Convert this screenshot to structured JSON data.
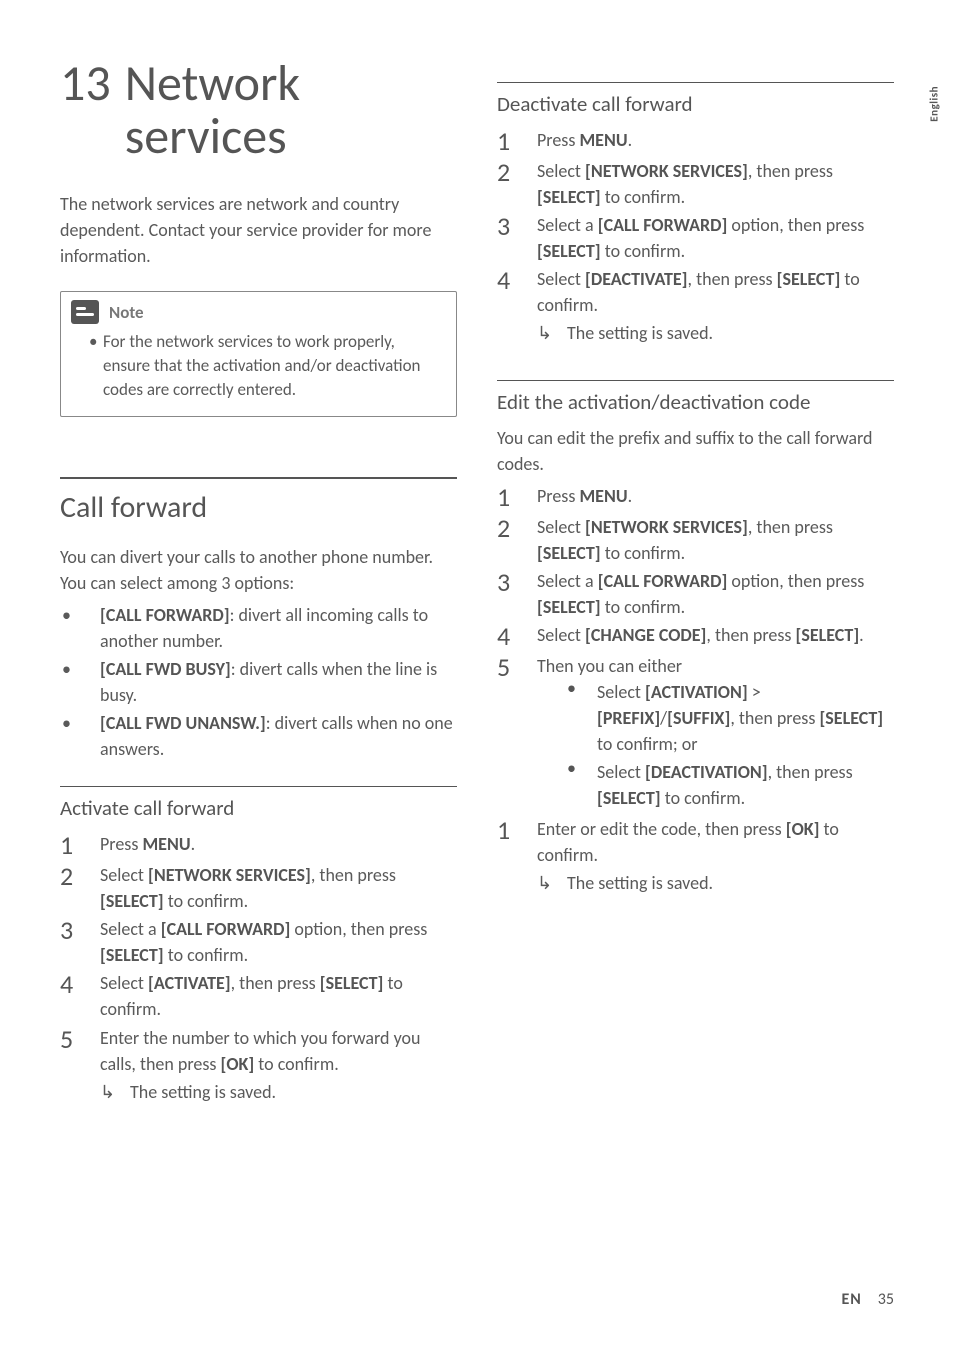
{
  "lang_tab": "English",
  "chapter": {
    "number": "13",
    "title": "Network services"
  },
  "intro": "The network services are network and country dependent. Contact your service provider for more information.",
  "note": {
    "label": "Note",
    "text": "For the network services to work properly, ensure that the activation and/or deactivation codes are correctly entered."
  },
  "section_call_forward": {
    "title": "Call forward",
    "intro": "You can divert your calls to another phone number. You can select among 3 options:",
    "options": [
      {
        "label": "[CALL FORWARD]",
        "desc": ": divert all incoming calls to another number."
      },
      {
        "label": "[CALL FWD BUSY]",
        "desc": ": divert calls when the line is busy."
      },
      {
        "label": "[CALL FWD UNANSW.]",
        "desc": ": divert calls when no one answers."
      }
    ]
  },
  "activate": {
    "title": "Activate call forward",
    "steps": [
      {
        "pre": "Press ",
        "b1": "MENU",
        "post": "."
      },
      {
        "pre": "Select ",
        "b1": "[NETWORK SERVICES]",
        "mid": ", then press ",
        "b2": "[SELECT]",
        "post": " to confirm."
      },
      {
        "pre": "Select a ",
        "b1": "[CALL FORWARD]",
        "mid": " option, then press ",
        "b2": "[SELECT]",
        "post": " to confirm."
      },
      {
        "pre": "Select ",
        "b1": "[ACTIVATE]",
        "mid": ", then press ",
        "b2": "[SELECT]",
        "post": " to confirm."
      },
      {
        "pre": "Enter the number to which you forward you calls, then press ",
        "b1": "[OK]",
        "post": " to confirm."
      }
    ],
    "result": "The setting is saved."
  },
  "deactivate": {
    "title": "Deactivate call forward",
    "steps": [
      {
        "pre": "Press ",
        "b1": "MENU",
        "post": "."
      },
      {
        "pre": "Select ",
        "b1": "[NETWORK SERVICES]",
        "mid": ", then press ",
        "b2": "[SELECT]",
        "post": " to confirm."
      },
      {
        "pre": "Select a ",
        "b1": "[CALL FORWARD]",
        "mid": " option, then press ",
        "b2": "[SELECT]",
        "post": " to confirm."
      },
      {
        "pre": "Select ",
        "b1": "[DEACTIVATE]",
        "mid": ", then press ",
        "b2": "[SELECT]",
        "post": " to confirm."
      }
    ],
    "result": "The setting is saved."
  },
  "edit_code": {
    "title": "Edit the activation/deactivation code",
    "intro": "You can edit the prefix and suffix to the call forward codes.",
    "steps": [
      {
        "pre": "Press ",
        "b1": "MENU",
        "post": "."
      },
      {
        "pre": "Select ",
        "b1": "[NETWORK SERVICES]",
        "mid": ", then press ",
        "b2": "[SELECT]",
        "post": " to confirm."
      },
      {
        "pre": "Select a ",
        "b1": "[CALL FORWARD]",
        "mid": " option, then press ",
        "b2": "[SELECT]",
        "post": " to confirm."
      },
      {
        "pre": "Select ",
        "b1": "[CHANGE CODE]",
        "mid": ", then press ",
        "b2": "[SELECT]",
        "post": "."
      },
      {
        "pre": "Then you can either"
      }
    ],
    "sub": [
      {
        "pre": "Select ",
        "b1": "[ACTIVATION]",
        "mid1": " > ",
        "b2": "[PREFIX]",
        "mid2": "/",
        "b3": "[SUFFIX]",
        "mid3": ", then press ",
        "b4": "[SELECT]",
        "post": " to confirm; or"
      },
      {
        "pre": "Select ",
        "b1": "[DEACTIVATION]",
        "mid1": ", then press ",
        "b2": "[SELECT]",
        "post": " to confirm."
      }
    ],
    "final_step": {
      "num": "1",
      "pre": "Enter or edit the code, then press ",
      "b1": "[OK]",
      "post": " to confirm."
    },
    "result": "The setting is saved."
  },
  "footer": {
    "lang": "EN",
    "page": "35"
  }
}
